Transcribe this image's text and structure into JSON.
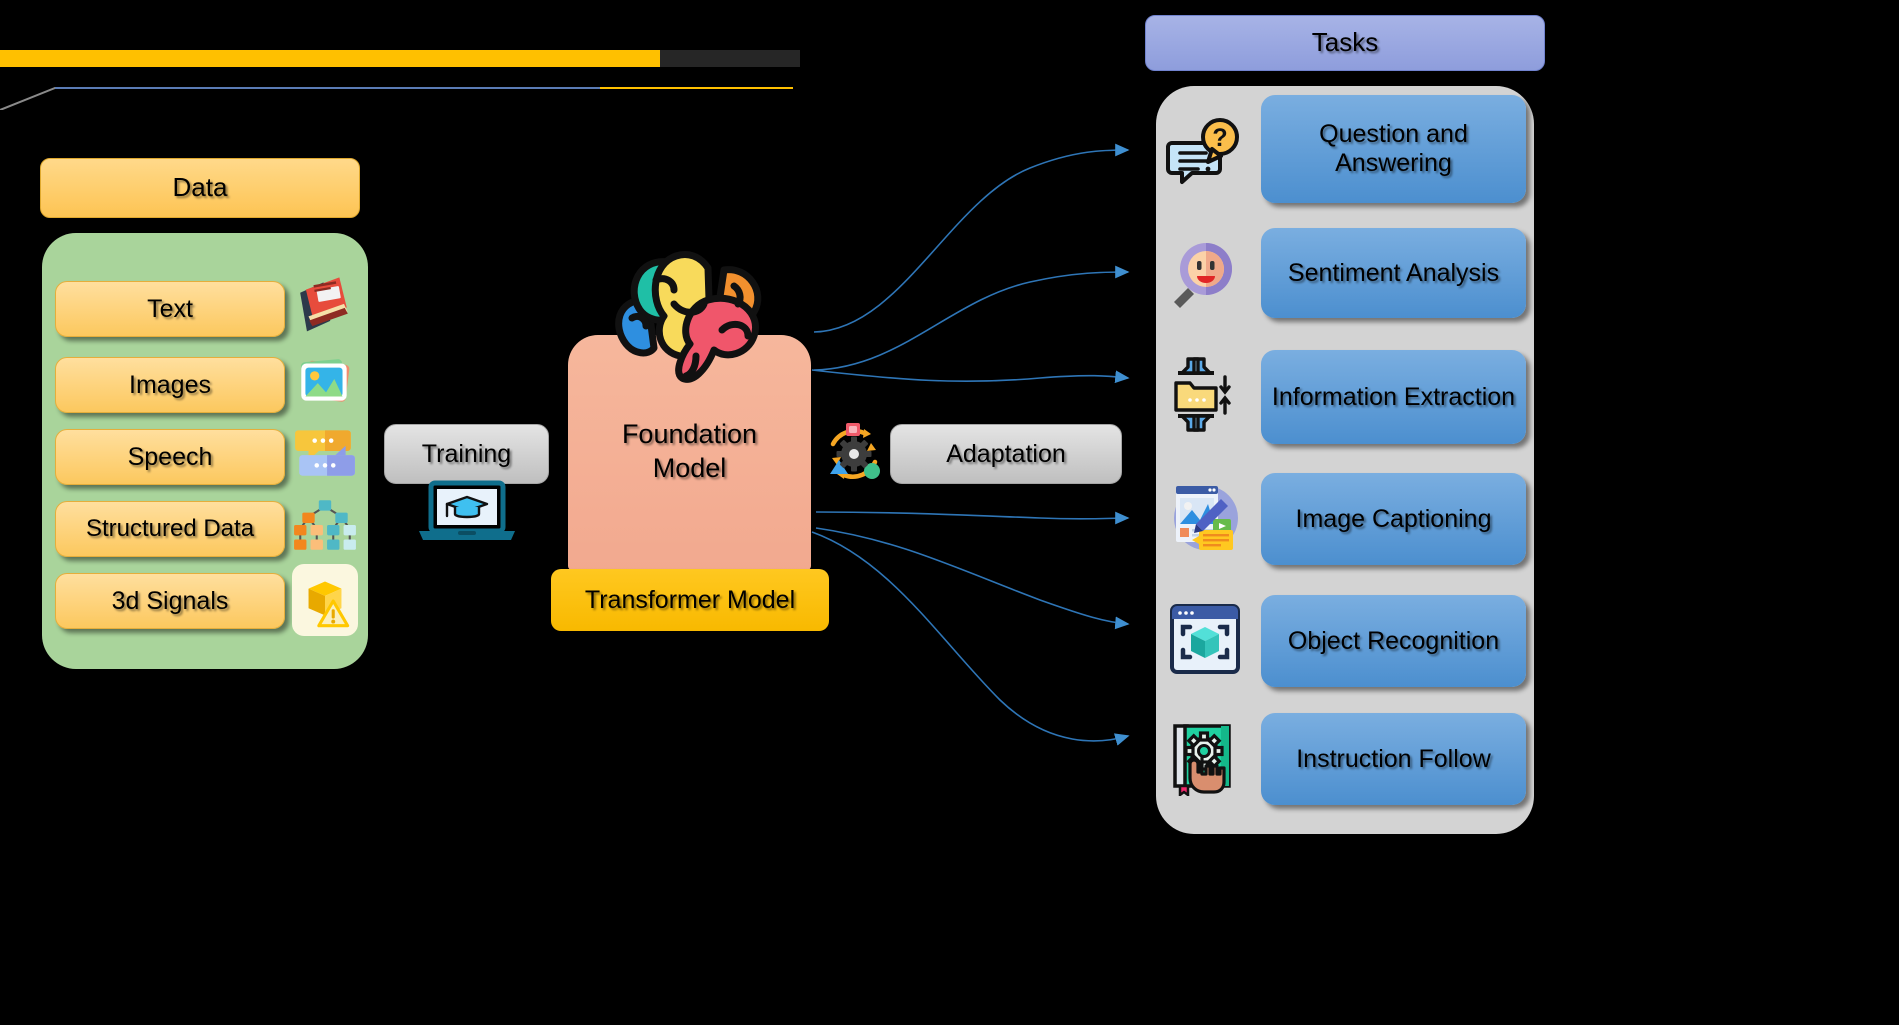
{
  "decor": {
    "thick_bar_color": "#FFC000",
    "thick_bar_tail_color": "#262626",
    "thin_line_colors": [
      "#8A8A8A",
      "#5B7CB5",
      "#FFC000"
    ]
  },
  "data_section": {
    "header": {
      "label": "Data",
      "color": "#FDC453"
    },
    "panel_color": "#A9D49B",
    "items": [
      {
        "label": "Text",
        "icon": "book-icon"
      },
      {
        "label": "Images",
        "icon": "photo-stack-icon"
      },
      {
        "label": "Speech",
        "icon": "chat-bubbles-icon"
      },
      {
        "label": "Structured Data",
        "icon": "tree-hierarchy-icon"
      },
      {
        "label": "3d Signals",
        "icon": "3d-box-warning-icon"
      }
    ]
  },
  "training": {
    "label": "Training",
    "icon": "laptop-graduation-cap-icon"
  },
  "adaptation": {
    "label": "Adaptation",
    "icon": "gear-cycle-icon"
  },
  "foundation": {
    "label": "Foundation\nModel",
    "line1": "Foundation",
    "line2": "Model",
    "icon": "colorful-brain-icon",
    "color": "#F2A98F",
    "sub_label": "Transformer Model",
    "sub_color": "#F8B900"
  },
  "tasks": {
    "header": {
      "label": "Tasks",
      "color": "#8E9DDC"
    },
    "panel_color": "#D3D3D3",
    "box_color": "#4C8FCF",
    "items": [
      {
        "label": "Question and Answering",
        "icon": "question-chat-icon"
      },
      {
        "label": "Sentiment Analysis",
        "icon": "magnifier-smiley-icon"
      },
      {
        "label": "Information Extraction",
        "icon": "folder-compress-icon"
      },
      {
        "label": "Image Captioning",
        "icon": "image-caption-icon"
      },
      {
        "label": "Object Recognition",
        "icon": "cube-scan-icon"
      },
      {
        "label": "Instruction Follow",
        "icon": "book-gear-hand-icon"
      }
    ]
  },
  "connectors": {
    "color": "#2E75B6",
    "count": 6
  }
}
